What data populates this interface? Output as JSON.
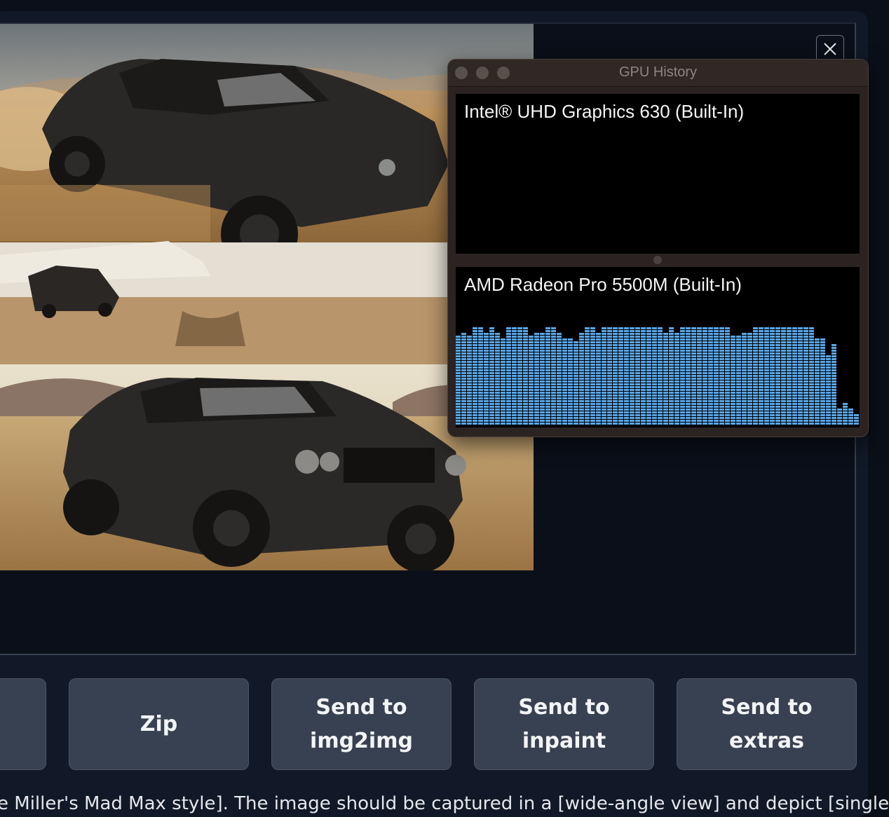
{
  "gallery": {
    "close_label": "close"
  },
  "gpu_window": {
    "title": "GPU History",
    "gpus": [
      {
        "name": "Intel® UHD Graphics 630 (Built-In)",
        "usage_history": []
      },
      {
        "name": "AMD Radeon Pro 5500M (Built-In)",
        "usage_history": [
          0.86,
          0.9,
          0.86,
          0.93,
          0.93,
          0.88,
          0.93,
          0.88,
          0.84,
          0.95,
          0.95,
          0.93,
          0.93,
          0.86,
          0.88,
          0.88,
          0.93,
          0.93,
          0.88,
          0.84,
          0.84,
          0.81,
          0.88,
          0.93,
          0.93,
          0.88,
          0.93,
          0.93,
          0.93,
          0.95,
          0.95,
          0.95,
          0.95,
          0.95,
          0.95,
          0.95,
          0.95,
          0.88,
          0.93,
          0.88,
          0.93,
          0.93,
          0.93,
          0.93,
          0.95,
          0.93,
          0.93,
          0.95,
          0.95,
          0.86,
          0.86,
          0.88,
          0.88,
          0.95,
          0.93,
          0.93,
          0.95,
          0.93,
          0.93,
          0.93,
          0.95,
          0.93,
          0.95,
          0.95,
          0.84,
          0.84,
          0.67,
          0.79,
          0.16,
          0.21,
          0.17,
          0.11,
          0.07
        ]
      }
    ],
    "bar_color": "#5aa6e6"
  },
  "buttons": {
    "prev": "",
    "zip": "Zip",
    "img2img": "Send to img2img",
    "inpaint": "Send to inpaint",
    "extras": "Send to extras"
  },
  "prompt_text": "e Miller's Mad Max style]. The image should be captured in a [wide-angle view] and depict [single] a"
}
